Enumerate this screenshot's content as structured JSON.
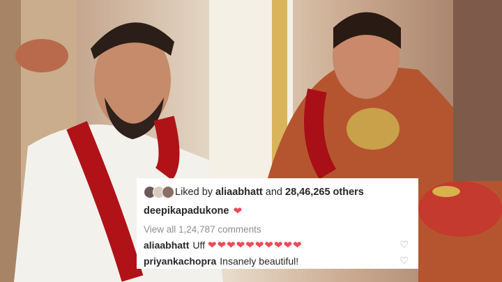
{
  "post": {
    "liked_by_prefix": "Liked by",
    "liked_by_user": "aliaabhatt",
    "liked_by_and": "and",
    "others_count": "28,46,265 others",
    "caption_user": "deepikapadukone",
    "caption_text": "❤",
    "view_comments": "View all 1,24,787 comments"
  },
  "comments": [
    {
      "user": "aliaabhatt",
      "text": "Uff",
      "hearts": "❤❤❤❤❤❤❤❤❤❤"
    },
    {
      "user": "priyankachopra",
      "text": "Insanely beautiful!"
    }
  ],
  "icons": {
    "like": "heart-outline-icon"
  },
  "colors": {
    "heart": "#ed4956",
    "muted": "#8e8e8e",
    "text": "#262626"
  }
}
